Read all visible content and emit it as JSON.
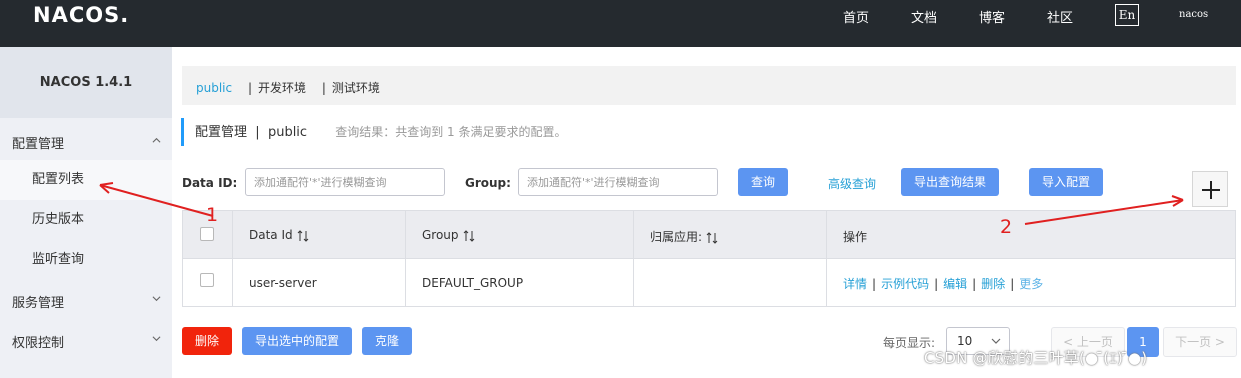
{
  "header": {
    "logo": "NACOS.",
    "nav": [
      "首页",
      "文档",
      "博客",
      "社区"
    ],
    "lang": "En",
    "user": "nacos"
  },
  "sidebar": {
    "title": "NACOS 1.4.1",
    "groups": [
      {
        "label": "配置管理",
        "items": [
          "配置列表",
          "历史版本",
          "监听查询"
        ]
      },
      {
        "label": "服务管理"
      },
      {
        "label": "权限控制"
      }
    ]
  },
  "namespaces": [
    "public",
    "开发环境",
    "测试环境"
  ],
  "page": {
    "title": "配置管理",
    "namespace": "public",
    "result_text": "查询结果：共查询到 1 条满足要求的配置。"
  },
  "search": {
    "data_id_label": "Data ID:",
    "data_id_placeholder": "添加通配符'*'进行模糊查询",
    "group_label": "Group:",
    "group_placeholder": "添加通配符'*'进行模糊查询",
    "query_button": "查询",
    "advanced_link": "高级查询",
    "export_button": "导出查询结果",
    "import_button": "导入配置"
  },
  "table": {
    "columns": [
      "Data Id",
      "Group",
      "归属应用:",
      "操作"
    ],
    "rows": [
      {
        "data_id": "user-server",
        "group": "DEFAULT_GROUP",
        "app": "",
        "ops": [
          "详情",
          "示例代码",
          "编辑",
          "删除",
          "更多"
        ]
      }
    ]
  },
  "bulk": {
    "delete": "删除",
    "export_selected": "导出选中的配置",
    "clone": "克隆"
  },
  "pagination": {
    "per_page_label": "每页显示:",
    "per_page_value": "10",
    "prev": "< 上一页",
    "current": "1",
    "next": "下一页 >"
  },
  "annotations": [
    "1",
    "2"
  ],
  "watermark": "CSDN @欣慰的三叶草(● ̄(ｴ) ̄●)",
  "colors": {
    "topbar": "#252a2f",
    "primary": "#5c95f1",
    "danger": "#f1240c",
    "link": "#26a0d6",
    "annotation": "#e02020"
  }
}
